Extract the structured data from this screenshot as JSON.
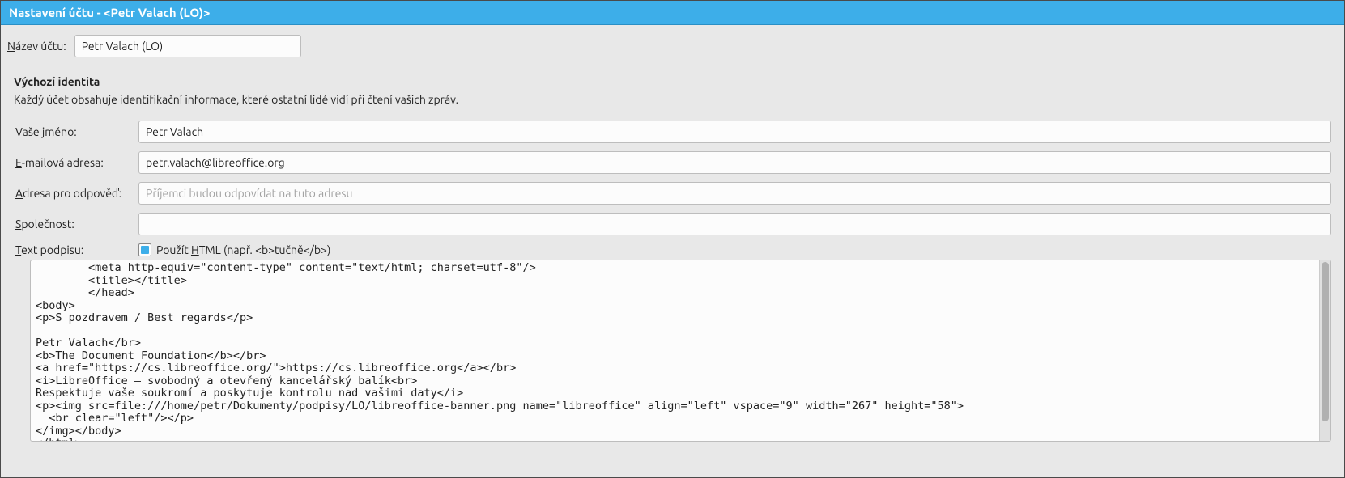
{
  "titlebar": "Nastavení účtu - <Petr Valach (LO)>",
  "account_name": {
    "label_pre": "N",
    "label_post": "ázev účtu:",
    "value": "Petr Valach (LO)"
  },
  "identity": {
    "heading": "Výchozí identita",
    "description": "Každý účet obsahuje identifikační informace, které ostatní lidé vidí při čtení vašich zpráv.",
    "name_label": "Vaše jméno:",
    "name_value": "Petr Valach",
    "email_label_pre": "E",
    "email_label_post": "-mailová adresa:",
    "email_value": "petr.valach@libreoffice.org",
    "reply_label_pre": "A",
    "reply_label_post": "dresa pro odpověď:",
    "reply_placeholder": "Příjemci budou odpovídat na tuto adresu",
    "reply_value": "",
    "org_label_pre": "S",
    "org_label_post": "polečnost:",
    "org_value": "",
    "sig_label_pre": "T",
    "sig_label_post": "ext podpisu:",
    "use_html_pre": "Použít ",
    "use_html_u": "H",
    "use_html_post": "TML (např. <b>tučně</b>)",
    "signature": "        <meta http-equiv=\"content-type\" content=\"text/html; charset=utf-8\"/>\n        <title></title>\n        </head>\n<body>\n<p>S pozdravem / Best regards</p>\n\nPetr Valach</br>\n<b>The Document Foundation</b></br>\n<a href=\"https://cs.libreoffice.org/\">https://cs.libreoffice.org</a></br>\n<i>LibreOffice – svobodný a otevřený kancelářský balík<br>\nRespektuje vaše soukromí a poskytuje kontrolu nad vašimi daty</i>\n<p><img src=file:///home/petr/Dokumenty/podpisy/LO/libreoffice-banner.png name=\"libreoffice\" align=\"left\" vspace=\"9\" width=\"267\" height=\"58\">\n  <br clear=\"left\"/></p>\n</img></body>\n</html>"
  }
}
